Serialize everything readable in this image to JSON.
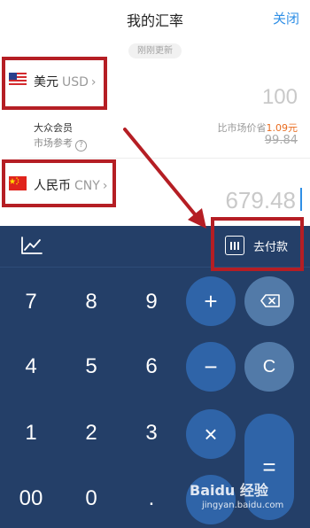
{
  "header": {
    "title": "我的汇率",
    "close_label": "关闭"
  },
  "update_tag": "刚刚更新",
  "usd": {
    "name": "美元",
    "code": "USD",
    "chevron": "›",
    "amount": "100"
  },
  "member": {
    "label": "大众会员",
    "market_ref": "市场参考",
    "help_glyph": "?"
  },
  "compare": {
    "prefix": "比市场价省",
    "saving": "1.09元",
    "old_amount": "99.84"
  },
  "cny": {
    "name": "人民币",
    "code": "CNY",
    "chevron": "›",
    "amount": "679.48"
  },
  "keypad": {
    "pay_label": "去付款",
    "keys": {
      "k7": "7",
      "k8": "8",
      "k9": "9",
      "k4": "4",
      "k5": "5",
      "k6": "6",
      "k1": "1",
      "k2": "2",
      "k3": "3",
      "k00": "00",
      "k0": "0",
      "kdot": ".",
      "plus": "+",
      "minus": "−",
      "times": "×",
      "clear": "C",
      "equals": "="
    }
  },
  "colors": {
    "accent": "#2f8fe6",
    "keypad_bg": "#243f68",
    "highlight": "#e96c1f",
    "annotation": "#b51e24"
  },
  "icons": {
    "chart": "line-chart-icon",
    "pay": "barcode-card-icon",
    "backspace": "backspace-icon",
    "flag_us": "us-flag-icon",
    "flag_cn": "china-flag-icon"
  },
  "watermark": {
    "text": "Baidu 经验",
    "url": "jingyan.baidu.com"
  }
}
